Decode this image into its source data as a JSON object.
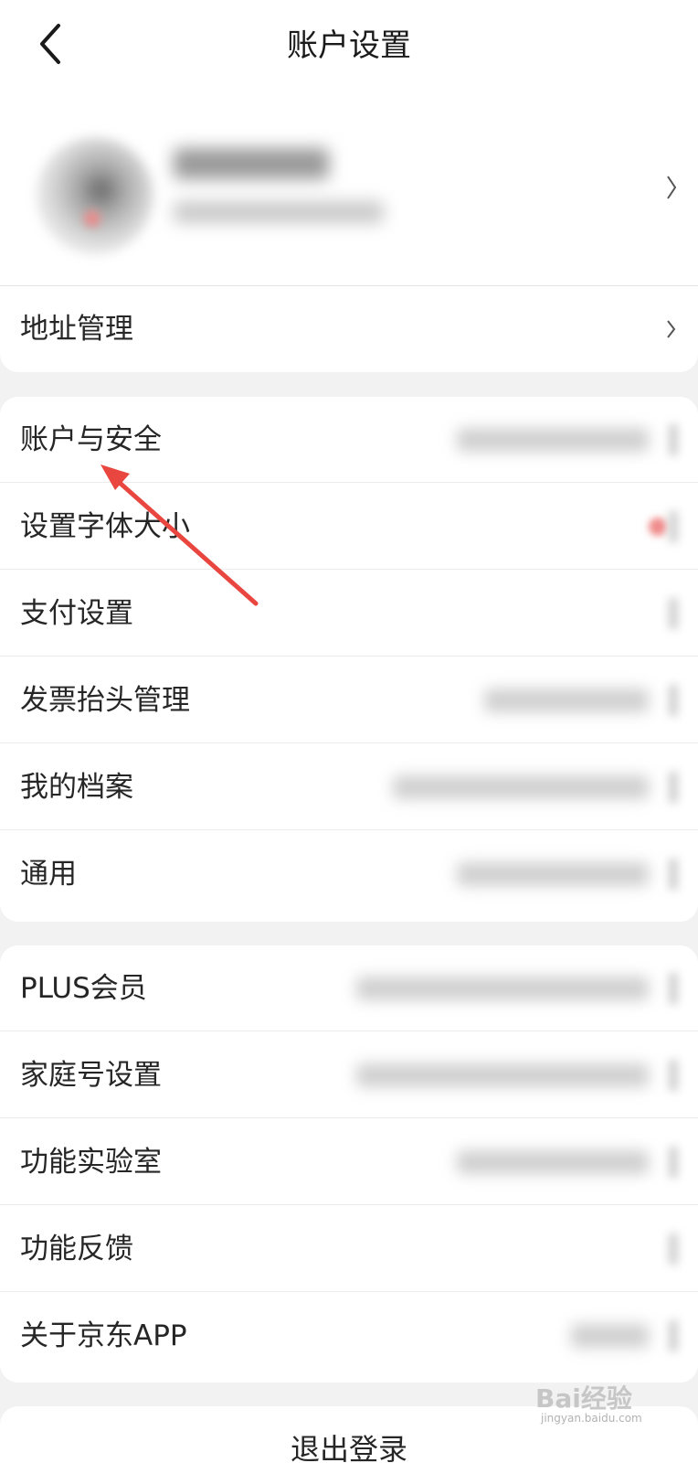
{
  "header": {
    "title": "账户设置",
    "back_icon": "chevron-left-icon"
  },
  "profile": {
    "avatar_icon": "avatar",
    "name": "",
    "subtitle": ""
  },
  "address_row": {
    "label": "地址管理"
  },
  "group1": {
    "items": [
      {
        "label": "账户与安全"
      },
      {
        "label": "设置字体大小"
      },
      {
        "label": "支付设置"
      },
      {
        "label": "发票抬头管理"
      },
      {
        "label": "我的档案"
      },
      {
        "label": "通用"
      }
    ]
  },
  "group2": {
    "items": [
      {
        "label": "PLUS会员"
      },
      {
        "label": "家庭号设置"
      },
      {
        "label": "功能实验室"
      },
      {
        "label": "功能反馈"
      },
      {
        "label": "关于京东APP"
      }
    ]
  },
  "logout": {
    "label": "退出登录"
  },
  "watermark": {
    "text": "Bai经验",
    "sub": "jingyan.baidu.com"
  },
  "colors": {
    "background": "#f2f2f2",
    "card": "#ffffff",
    "annotation_arrow": "#e8463f"
  }
}
